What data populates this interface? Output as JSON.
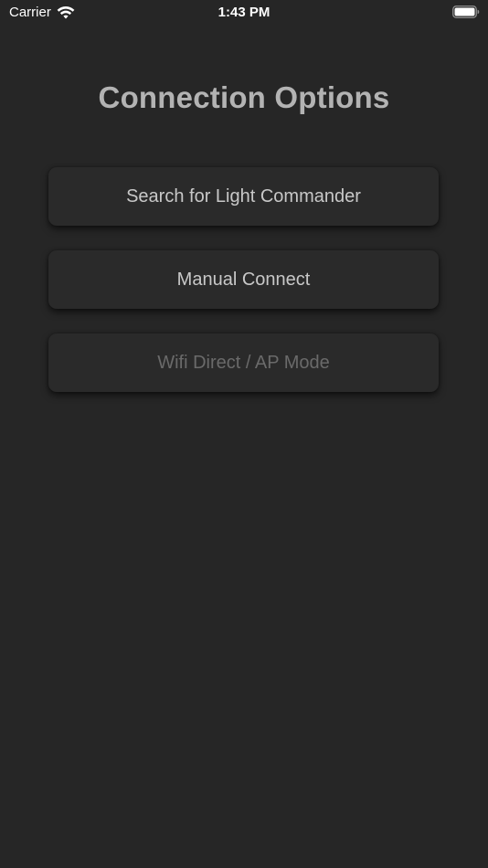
{
  "status_bar": {
    "carrier": "Carrier",
    "time": "1:43 PM",
    "wifi_icon": "wifi-icon",
    "battery_icon": "battery-icon"
  },
  "screen": {
    "title": "Connection Options"
  },
  "options": {
    "search_label": "Search for Light Commander",
    "manual_label": "Manual Connect",
    "wifi_direct_label": "Wifi Direct / AP Mode",
    "wifi_direct_enabled": false
  },
  "colors": {
    "background": "#262626",
    "button_background": "#2a2a2a",
    "title_text": "#b3b3b3",
    "button_text": "#c8c8c8",
    "disabled_text": "#6a6a6a"
  }
}
